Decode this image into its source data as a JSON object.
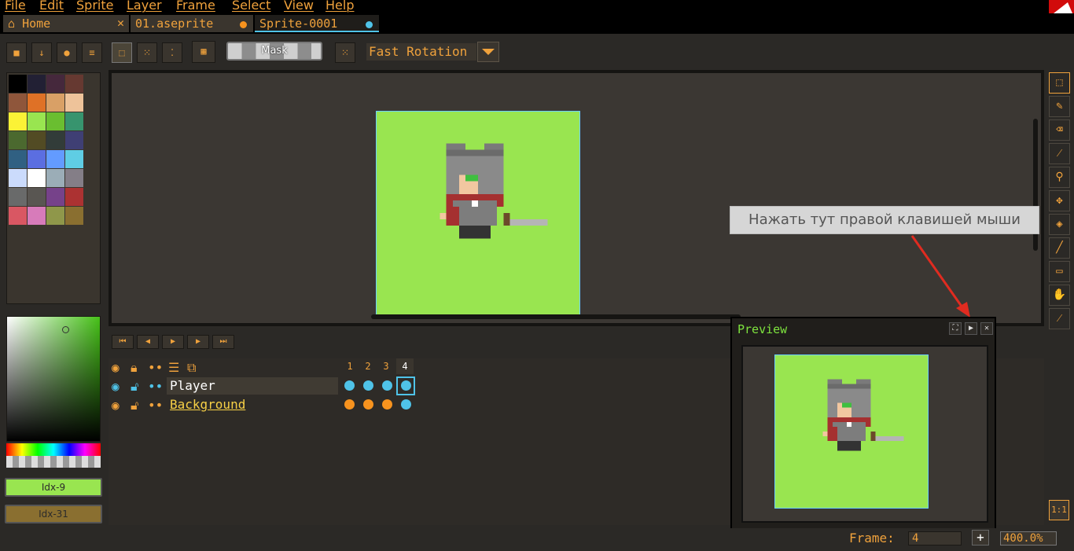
{
  "menu": [
    "File",
    "Edit",
    "Sprite",
    "Layer",
    "Frame",
    "Select",
    "View",
    "Help"
  ],
  "tabs": [
    {
      "label": "Home",
      "icon": "home-icon"
    },
    {
      "label": "01.aseprite"
    },
    {
      "label": "Sprite-0001"
    }
  ],
  "toolbar": {
    "mask_label": "Mask",
    "rotation_label": "Fast Rotation"
  },
  "palette": {
    "colors": [
      "#000000",
      "#222034",
      "#45283c",
      "#663931",
      "#8f563b",
      "#df7126",
      "#d9a066",
      "#eec39a",
      "#fbf236",
      "#99e550",
      "#6abe30",
      "#37946e",
      "#4b692f",
      "#524b24",
      "#323c39",
      "#3f3f74",
      "#306082",
      "#5b6ee1",
      "#639bff",
      "#5fcde4",
      "#cbdbfc",
      "#ffffff",
      "#9badb7",
      "#847e87",
      "#696a6a",
      "#595652",
      "#76428a",
      "#ac3232",
      "#d95763",
      "#d77bba",
      "#8f974a",
      "#8a6f30"
    ],
    "fg_label": "Idx-9",
    "bg_label": "Idx-31",
    "fg_color": "#99e550",
    "bg_color": "#8a6f30"
  },
  "canvas": {
    "background": "#99e550"
  },
  "tooltip": "Нажать тут правой клавишей мыши",
  "timeline": {
    "frames": [
      "1",
      "2",
      "3",
      "4"
    ],
    "layers": [
      {
        "name": "Player"
      },
      {
        "name": "Background"
      }
    ]
  },
  "preview": {
    "title": "Preview"
  },
  "status": {
    "frame_label": "Frame:",
    "frame_value": "4",
    "zoom": "400.0%",
    "one_to_one": "1:1"
  },
  "colors": {
    "accent": "#f0a23c",
    "cel_blue": "#4fc3e8",
    "cel_orange": "#f7931e",
    "preview_title": "#7ee43e"
  },
  "icons": [
    "home-icon",
    "close-icon",
    "lock-icon",
    "eye-icon",
    "rectangle-marquee-icon",
    "pencil-icon",
    "eraser-icon",
    "eyedropper-icon",
    "zoom-icon",
    "move-icon",
    "paint-bucket-icon",
    "line-icon",
    "rectangle-icon",
    "hand-icon",
    "brush-icon"
  ]
}
